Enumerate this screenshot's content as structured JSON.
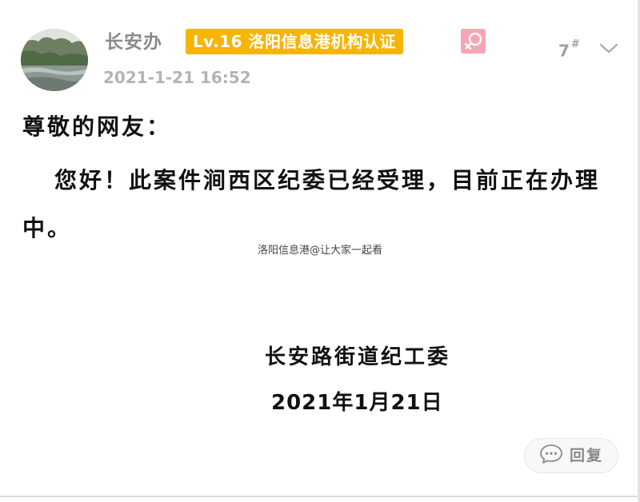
{
  "post": {
    "author": {
      "name": "长安办",
      "level_badge": "Lv.16 洛阳信息港机构认证",
      "gender_icon": "female-icon",
      "avatar_icon": "landscape-avatar"
    },
    "floor": "7",
    "floor_suffix": "#",
    "timestamp": "2021-1-21 16:52",
    "greeting": "尊敬的网友：",
    "body": "您好！此案件涧西区纪委已经受理，目前正在办理中。",
    "watermark": "洛阳信息港@让大家一起看",
    "signature": {
      "org": "长安路街道纪工委",
      "date": "2021年1月21日"
    },
    "reply_button": {
      "icon": "comment-icon",
      "label": "回复"
    }
  },
  "colors": {
    "level_badge_bg": "#f7b500",
    "gender_badge_bg": "#f6a6b3",
    "meta_text": "#a0a0a0"
  }
}
